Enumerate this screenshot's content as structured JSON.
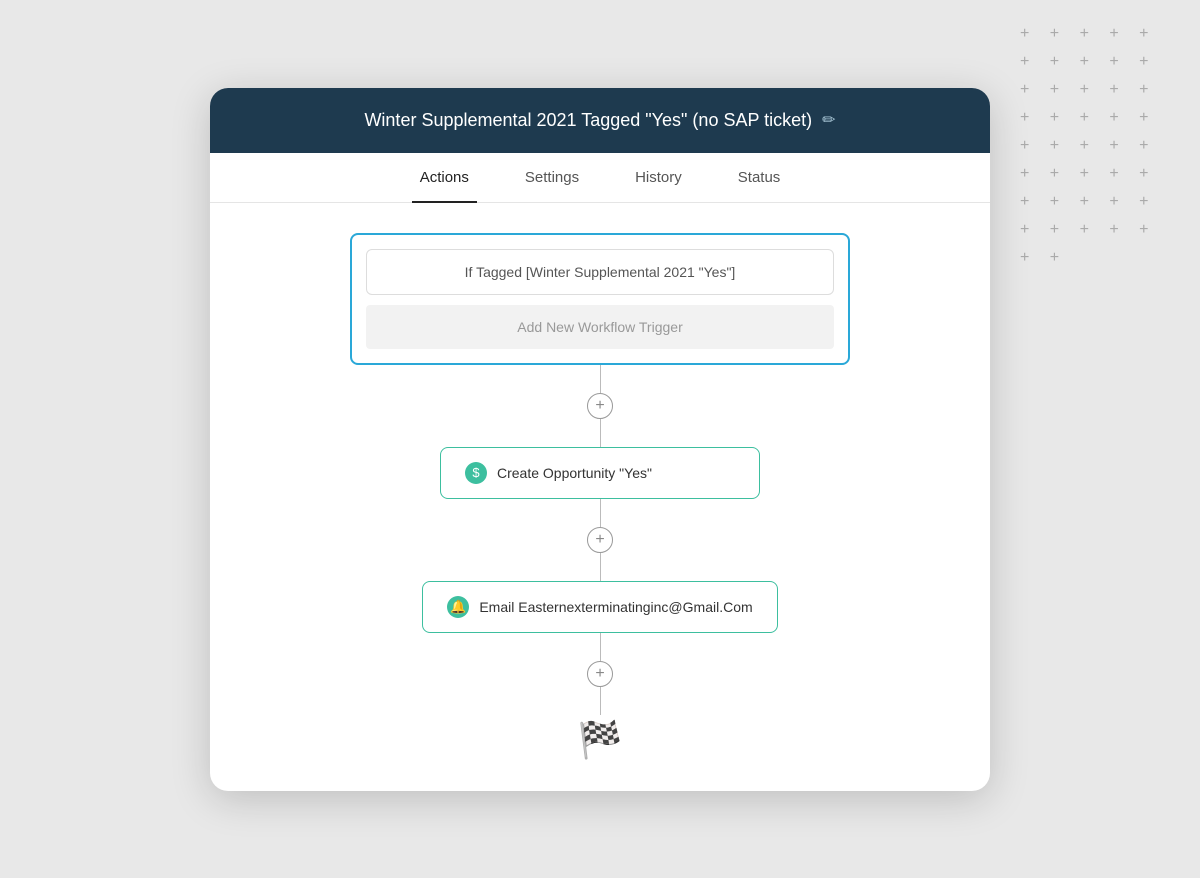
{
  "card": {
    "title": "Winter Supplemental 2021 Tagged \"Yes\" (no SAP ticket)",
    "edit_icon": "✏"
  },
  "tabs": [
    {
      "id": "actions",
      "label": "Actions",
      "active": true
    },
    {
      "id": "settings",
      "label": "Settings",
      "active": false
    },
    {
      "id": "history",
      "label": "History",
      "active": false
    },
    {
      "id": "status",
      "label": "Status",
      "active": false
    }
  ],
  "trigger": {
    "condition_label": "If Tagged [Winter Supplemental 2021 \"Yes\"]",
    "add_label": "Add New Workflow Trigger"
  },
  "actions": [
    {
      "id": "create-opportunity",
      "icon_type": "dollar",
      "icon_symbol": "$",
      "label": "Create Opportunity \"Yes\""
    },
    {
      "id": "email-action",
      "icon_type": "bell",
      "icon_symbol": "🔔",
      "label": "Email Easternexterminatinginc@Gmail.Com"
    }
  ],
  "add_button_label": "+",
  "finish_icon": "🏁",
  "bg_plus": "+ + + + + +\n+ + + + + +\n+ + + + + +\n+ + + + + +\n+ + + + + +\n+ + + + + +\n+ + + + + +"
}
